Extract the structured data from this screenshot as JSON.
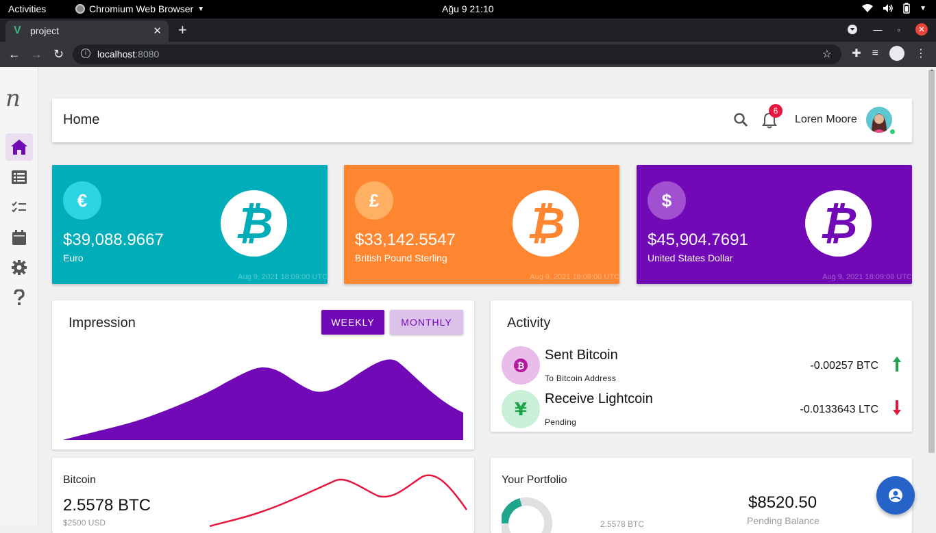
{
  "os": {
    "activities": "Activities",
    "app_name": "Chromium Web Browser",
    "clock": "Ağu 9  21:10"
  },
  "browser": {
    "tab_title": "project",
    "url_host": "localhost",
    "url_port": ":8080"
  },
  "header": {
    "title": "Home",
    "notification_count": "6",
    "user_name": "Loren Moore"
  },
  "sidebar": {
    "logo": "n",
    "items": [
      {
        "icon": "home-icon",
        "active": true
      },
      {
        "icon": "list-icon",
        "active": false
      },
      {
        "icon": "checklist-icon",
        "active": false
      },
      {
        "icon": "calendar-icon",
        "active": false
      },
      {
        "icon": "gear-icon",
        "active": false
      },
      {
        "icon": "help-icon",
        "active": false
      }
    ]
  },
  "currencies": [
    {
      "symbol": "€",
      "value": "$39,088.9667",
      "name": "Euro",
      "date": "Aug 9, 2021 18:09:00 UTC",
      "color": "#00adb9",
      "light": "#2dd4e3"
    },
    {
      "symbol": "£",
      "value": "$33,142.5547",
      "name": "British Pound Sterling",
      "date": "Aug 9, 2021 18:09:00 UTC",
      "color": "#ff8630",
      "light": "#ffb063"
    },
    {
      "symbol": "$",
      "value": "$45,904.7691",
      "name": "United States Dollar",
      "date": "Aug 9, 2021 18:09:00 UTC",
      "color": "#7209b7",
      "light": "#a150d0"
    }
  ],
  "impression": {
    "title": "Impression",
    "weekly_label": "WEEKLY",
    "monthly_label": "MONTHLY"
  },
  "activity": {
    "title": "Activity",
    "items": [
      {
        "title": "Sent Bitcoin",
        "subtitle": "To Bitcoin Address",
        "amount": "-0.00257 BTC",
        "direction": "up",
        "icon": "bitcoin-icon",
        "icon_char": "₿",
        "bg": "#eabcea",
        "fg": "#b5179e",
        "arrow_color": "#1ea54c"
      },
      {
        "title": "Receive Lightcoin",
        "subtitle": "Pending",
        "amount": "-0.0133643 LTC",
        "direction": "down",
        "icon": "yen-icon",
        "icon_char": "¥",
        "bg": "#c8f0d6",
        "fg": "#1ea54c",
        "arrow_color": "#e5173f"
      }
    ]
  },
  "bitcoin": {
    "label": "Bitcoin",
    "value": "2.5578 BTC",
    "usd": "$2500 USD"
  },
  "portfolio": {
    "title": "Your Portfolio",
    "btc": "2.5578 BTC",
    "amount": "$8520.50",
    "pending_label": "Pending Balance"
  },
  "colors": {
    "accent": "#7209b7",
    "line": "#e5173f"
  }
}
